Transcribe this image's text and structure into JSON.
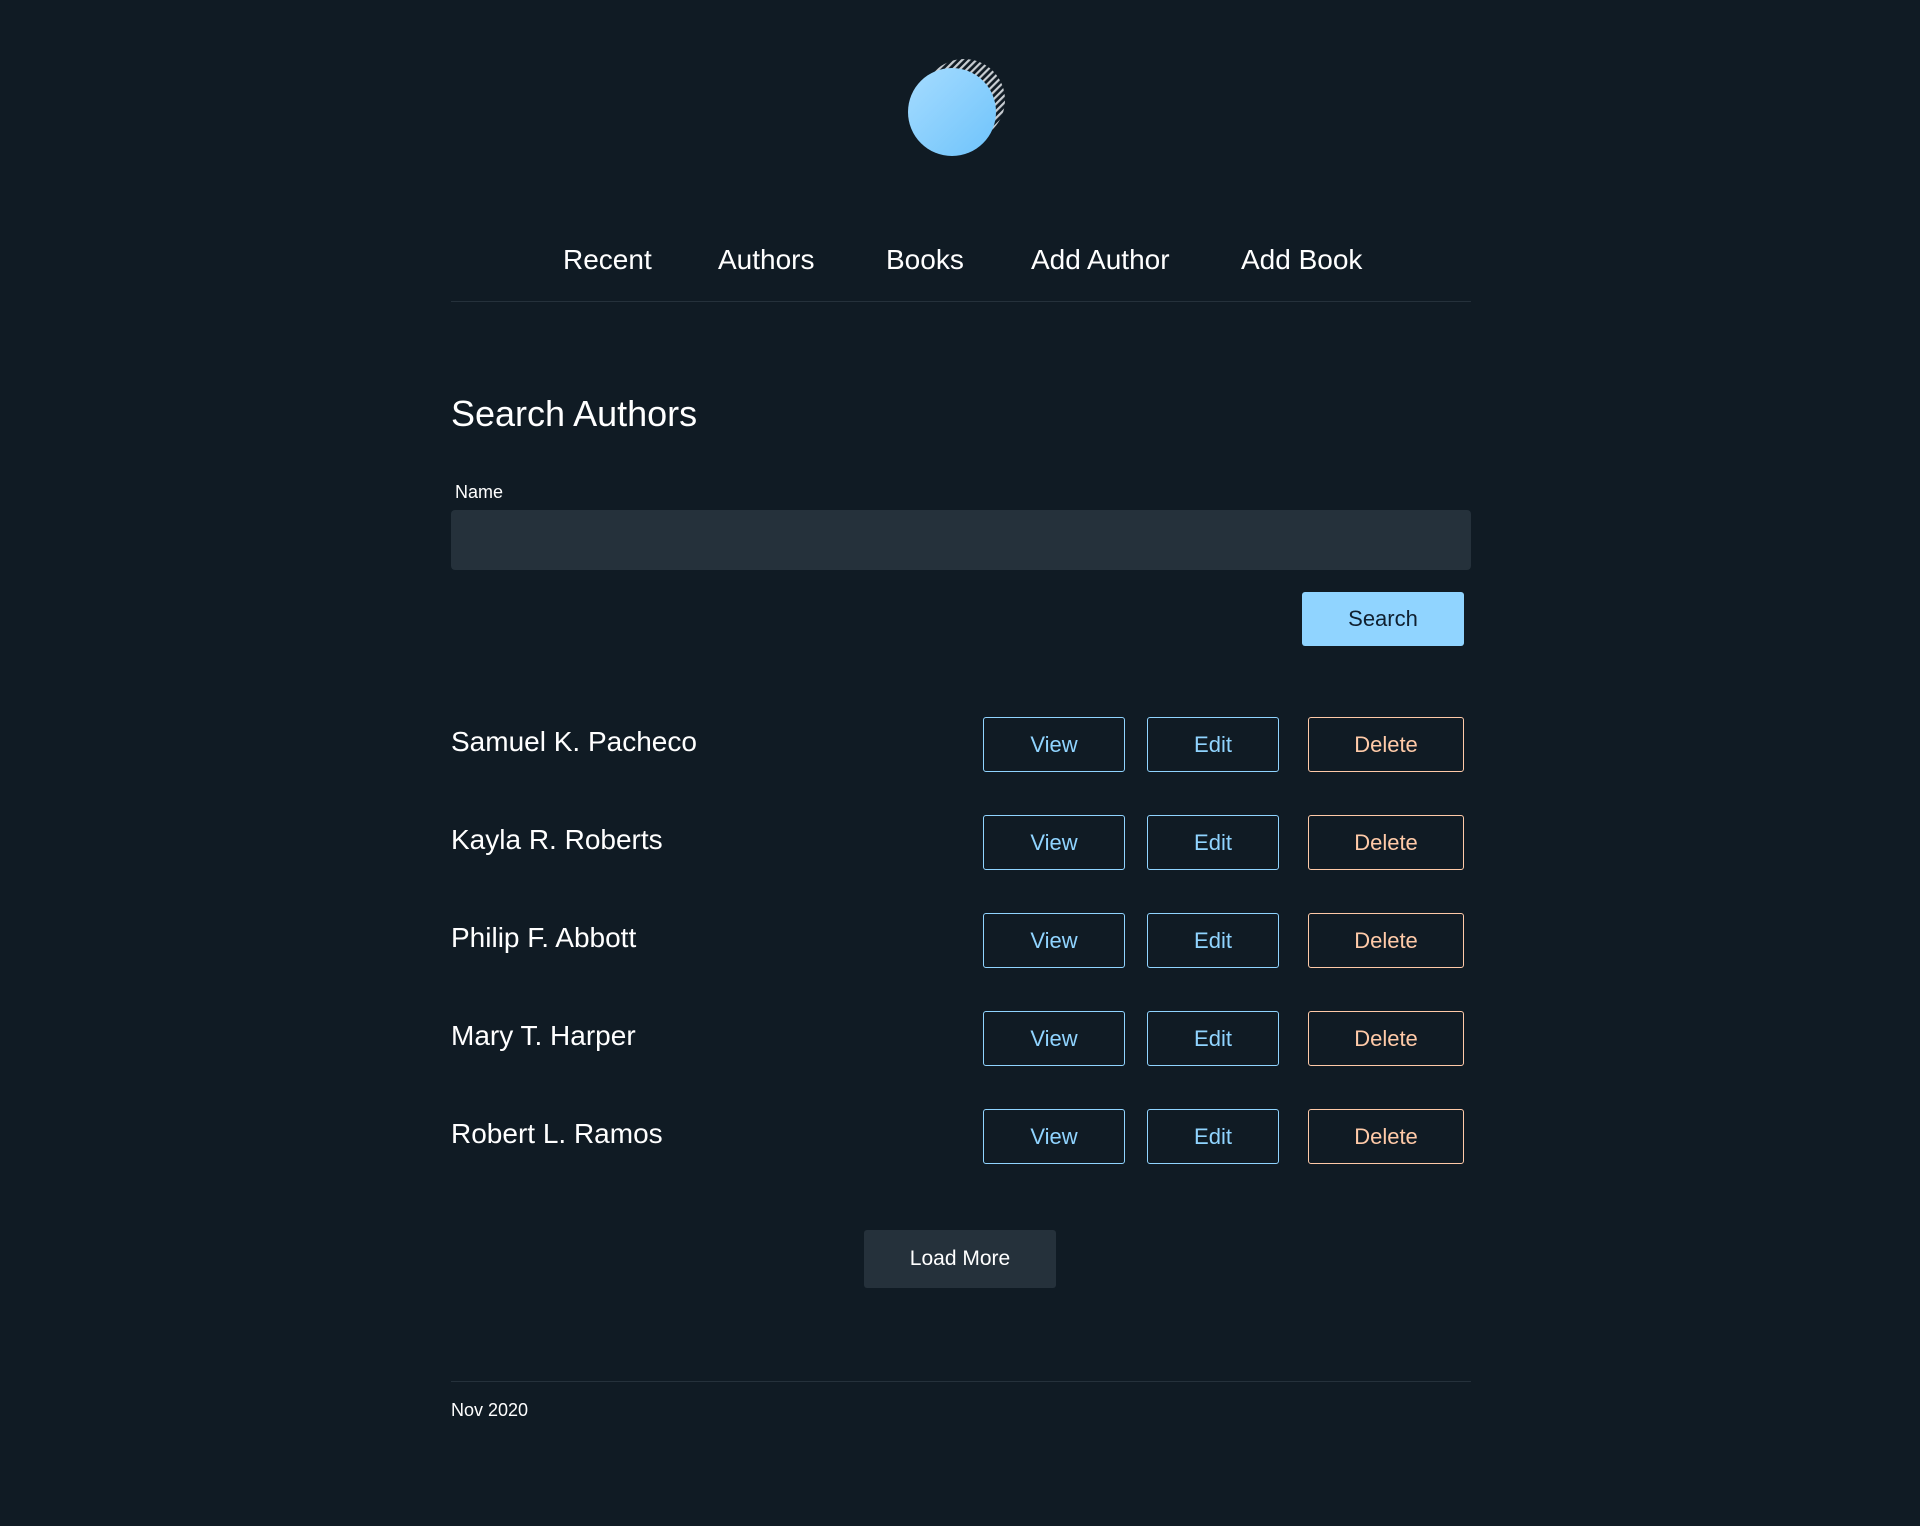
{
  "colors": {
    "background": "#101b24",
    "surface": "#25313b",
    "accent": "#90d4ff",
    "danger": "#ffcaa8",
    "text": "#ffffff"
  },
  "header": {
    "logo_icon": "circle-logo-icon"
  },
  "nav": {
    "items": [
      {
        "label": "Recent"
      },
      {
        "label": "Authors"
      },
      {
        "label": "Books"
      },
      {
        "label": "Add Author"
      },
      {
        "label": "Add Book"
      }
    ]
  },
  "main": {
    "title": "Search Authors",
    "search": {
      "name_label": "Name",
      "name_value": "",
      "button_label": "Search"
    },
    "authors": [
      {
        "name": "Samuel K. Pacheco"
      },
      {
        "name": "Kayla R. Roberts"
      },
      {
        "name": "Philip F. Abbott"
      },
      {
        "name": "Mary T. Harper"
      },
      {
        "name": "Robert L. Ramos"
      }
    ],
    "row_actions": {
      "view_label": "View",
      "edit_label": "Edit",
      "delete_label": "Delete"
    },
    "load_more_label": "Load More"
  },
  "footer": {
    "text": "Nov 2020"
  }
}
